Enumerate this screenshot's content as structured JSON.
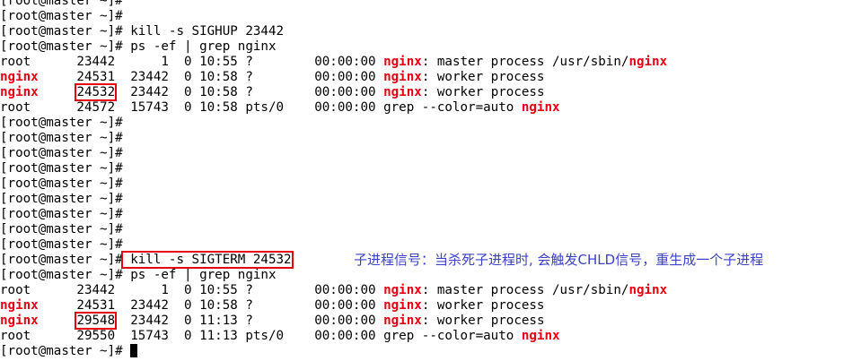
{
  "terminal": {
    "lines": [
      [
        {
          "t": "[root@master ~]#"
        }
      ],
      [
        {
          "t": "[root@master ~]#"
        }
      ],
      [
        {
          "t": "[root@master ~]# kill -s SIGHUP 23442"
        }
      ],
      [
        {
          "t": "[root@master ~]# ps -ef | grep nginx"
        }
      ],
      [
        {
          "t": "root      23442      1  0 10:55 ?        00:00:00 "
        },
        {
          "t": "nginx",
          "hl": true
        },
        {
          "t": ": master process /usr/sbin/"
        },
        {
          "t": "nginx",
          "hl": true
        }
      ],
      [
        {
          "t": "nginx",
          "hl": true
        },
        {
          "t": "     24531  23442  0 10:58 ?        00:00:00 "
        },
        {
          "t": "nginx",
          "hl": true
        },
        {
          "t": ": worker process"
        }
      ],
      [
        {
          "t": "nginx",
          "hl": true
        },
        {
          "t": "     "
        },
        {
          "t": "24532",
          "box": true
        },
        {
          "t": "  23442  0 10:58 ?        00:00:00 "
        },
        {
          "t": "nginx",
          "hl": true
        },
        {
          "t": ": worker process"
        }
      ],
      [
        {
          "t": "root      24572  15743  0 10:58 pts/0    00:00:00 grep --color=auto "
        },
        {
          "t": "nginx",
          "hl": true
        }
      ],
      [
        {
          "t": "[root@master ~]#"
        }
      ],
      [
        {
          "t": "[root@master ~]#"
        }
      ],
      [
        {
          "t": "[root@master ~]#"
        }
      ],
      [
        {
          "t": "[root@master ~]#"
        }
      ],
      [
        {
          "t": "[root@master ~]#"
        }
      ],
      [
        {
          "t": "[root@master ~]#"
        }
      ],
      [
        {
          "t": "[root@master ~]#"
        }
      ],
      [
        {
          "t": "[root@master ~]#"
        }
      ],
      [
        {
          "t": "[root@master ~]#"
        }
      ],
      [
        {
          "t": "[root@master ~]#"
        },
        {
          "t": " kill -s SIGTERM 24532",
          "box": true
        }
      ],
      [
        {
          "t": "[root@master ~]# ps -ef | grep nginx"
        }
      ],
      [
        {
          "t": "root      23442      1  0 10:55 ?        00:00:00 "
        },
        {
          "t": "nginx",
          "hl": true
        },
        {
          "t": ": master process /usr/sbin/"
        },
        {
          "t": "nginx",
          "hl": true
        }
      ],
      [
        {
          "t": "nginx",
          "hl": true
        },
        {
          "t": "     24531  23442  0 10:58 ?        00:00:00 "
        },
        {
          "t": "nginx",
          "hl": true
        },
        {
          "t": ": worker process"
        }
      ],
      [
        {
          "t": "nginx",
          "hl": true
        },
        {
          "t": "     "
        },
        {
          "t": "29548",
          "box": true
        },
        {
          "t": "  23442  0 11:13 ?        00:00:00 "
        },
        {
          "t": "nginx",
          "hl": true
        },
        {
          "t": ": worker process"
        }
      ],
      [
        {
          "t": "root      29550  15743  0 11:13 pts/0    00:00:00 grep --color=auto "
        },
        {
          "t": "nginx",
          "hl": true
        }
      ],
      [
        {
          "t": "[root@master ~]# "
        },
        {
          "cursor": true
        }
      ]
    ]
  },
  "annotation": {
    "text": "子进程信号：当杀死子进程时, 会触发CHLD信号，重生成一个子进程"
  },
  "colors": {
    "highlight": "#e60012",
    "annotation": "#3b41c4",
    "text": "#000000",
    "background": "#ffffff"
  }
}
